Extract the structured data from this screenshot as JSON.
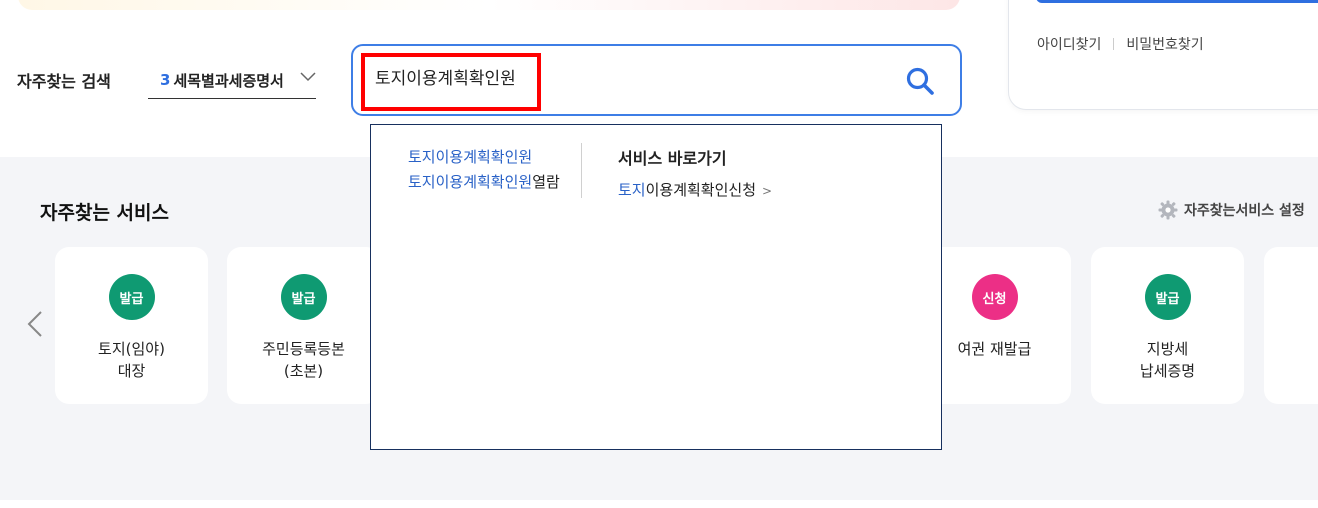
{
  "login": {
    "find_id": "아이디찾기",
    "find_password": "비밀번호찾기"
  },
  "search": {
    "title": "자주찾는 검색",
    "select_number": "3",
    "select_label": "세목별과세증명서",
    "query": "토지이용계획확인원"
  },
  "autocomplete": {
    "suggestions": [
      {
        "match": "토지이용계획확인원",
        "rest": ""
      },
      {
        "match": "토지이용계획확인원",
        "rest": "열람"
      }
    ],
    "shortcut_title": "서비스 바로가기",
    "shortcut_match": "토지",
    "shortcut_rest": "이용계획확인신청"
  },
  "services": {
    "title": "자주찾는 서비스",
    "setting_label": "자주찾는서비스 설정",
    "cards": [
      {
        "badge": "발급",
        "line1": "토지(임야)",
        "line2": "대장",
        "badge_color": "#0f9a72"
      },
      {
        "badge": "발급",
        "line1": "주민등록등본",
        "line2": "(초본)",
        "badge_color": "#0f9a72"
      },
      {
        "badge": "신청",
        "line1": "여권 재발급",
        "line2": "",
        "badge_color": "#ec2f86"
      },
      {
        "badge": "발급",
        "line1": "지방세",
        "line2": "납세증명",
        "badge_color": "#0f9a72"
      }
    ]
  },
  "colors": {
    "accent": "#3e7ee6",
    "highlight": "#ff0000",
    "issue_badge": "#0f9a72",
    "apply_badge": "#ec2f86"
  }
}
